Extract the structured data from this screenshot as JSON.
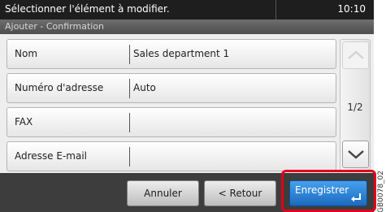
{
  "header": {
    "message": "Sélectionner l'élément à modifier.",
    "time": "10:10",
    "subtitle": "Ajouter - Confirmation"
  },
  "fields": [
    {
      "label": "Nom",
      "value": "Sales department 1"
    },
    {
      "label": "Numéro d'adresse",
      "value": "Auto"
    },
    {
      "label": "FAX",
      "value": ""
    },
    {
      "label": "Adresse E-mail",
      "value": ""
    }
  ],
  "scroll": {
    "page_indicator": "1/2",
    "up_icon": "chevron-up-icon",
    "down_icon": "chevron-down-icon"
  },
  "footer": {
    "cancel_label": "Annuler",
    "back_label": "< Retour",
    "save_label": "Enregistrer",
    "save_icon": "enter-icon"
  },
  "colors": {
    "save_button": "#1c6ac0",
    "highlight_frame": "#e0001b",
    "header_bar": "#1e1e1e"
  },
  "side_code": "GB0078_02"
}
